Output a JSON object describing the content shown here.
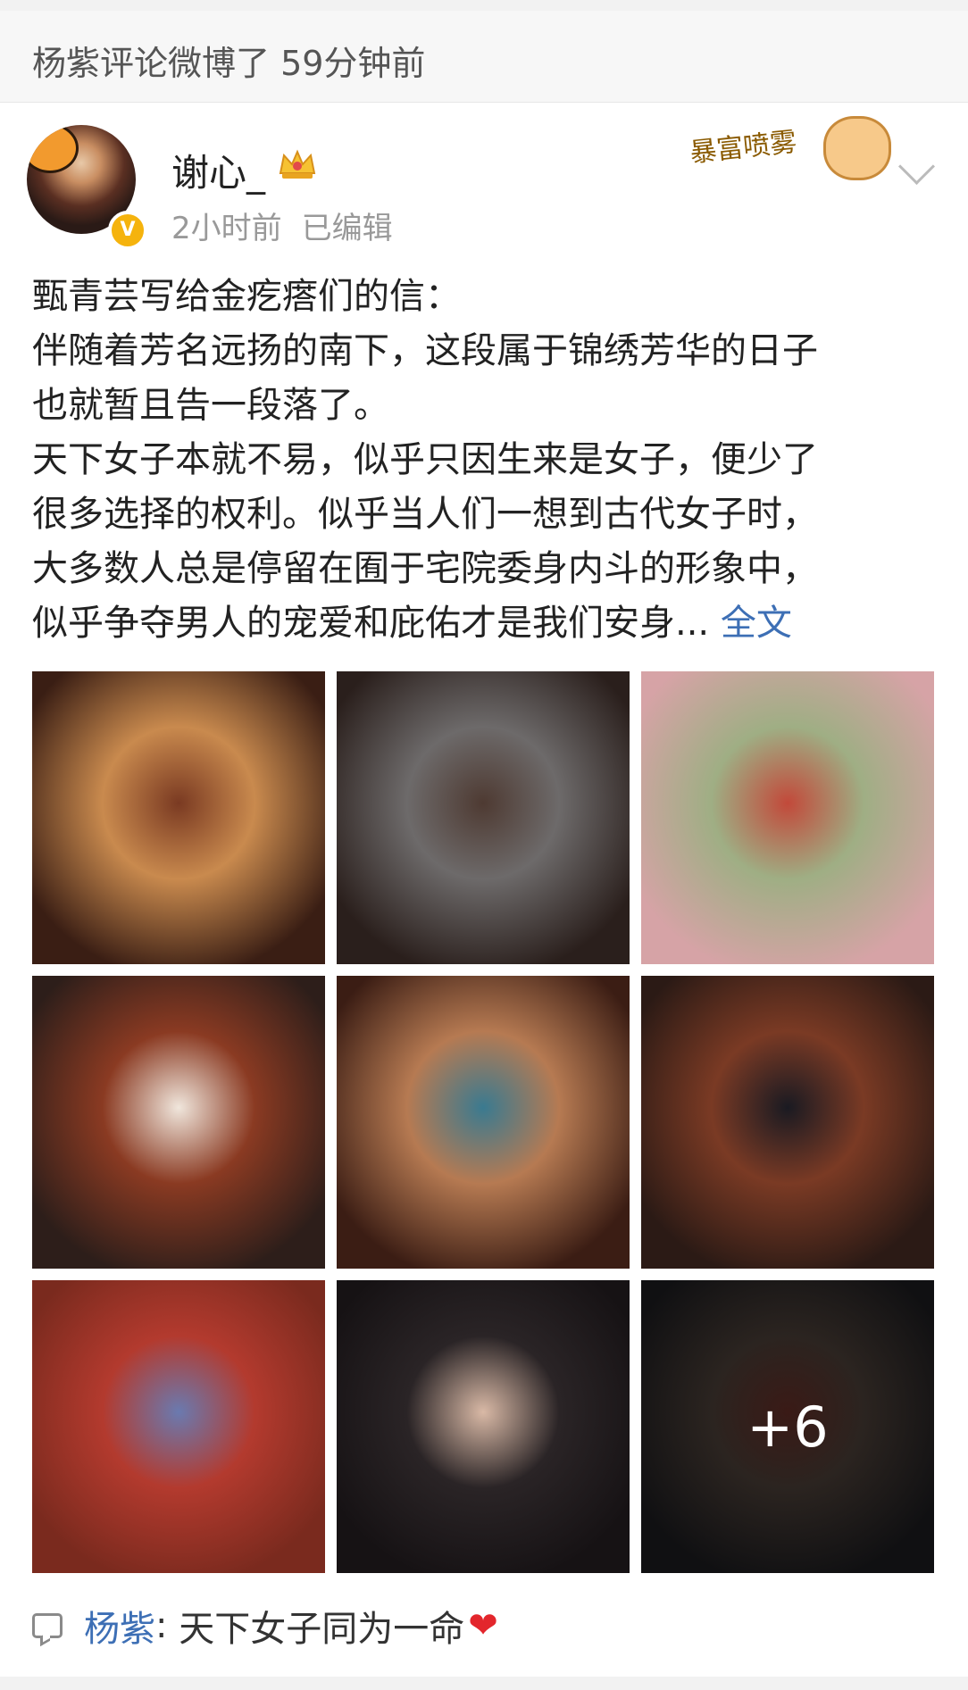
{
  "notification": {
    "text": "杨紫评论微博了 59分钟前"
  },
  "author": {
    "name": "谢心_",
    "time": "2小时前",
    "edited": "已编辑",
    "verified_badge": "V"
  },
  "sticker": {
    "text": "暴富喷雾"
  },
  "post": {
    "lines": [
      "甄青芸写给金疙瘩们的信：",
      "伴随着芳名远扬的南下，这段属于锦绣芳华的日子",
      "也就暂且告一段落了。",
      "天下女子本就不易，似乎只因生来是女子，便少了",
      "很多选择的权利。似乎当人们一想到古代女子时，",
      "大多数人总是停留在囿于宅院委身内斗的形象中，",
      "似乎争夺男人的宠爱和庇佑才是我们安身..."
    ],
    "full_text_link": "全文"
  },
  "photos": {
    "items": [
      {
        "name": "photo-1",
        "colors": [
          "#3a1e14",
          "#c98a4e",
          "#7a3a22"
        ]
      },
      {
        "name": "photo-2",
        "colors": [
          "#2a1f1c",
          "#6d6a6a",
          "#4e3a32"
        ]
      },
      {
        "name": "photo-3",
        "colors": [
          "#d6a3a6",
          "#9fae84",
          "#c2493a"
        ]
      },
      {
        "name": "photo-4",
        "colors": [
          "#2d1e1a",
          "#8a3a22",
          "#f0e6dc"
        ]
      },
      {
        "name": "photo-5",
        "colors": [
          "#3b1d14",
          "#b67a52",
          "#3a7a90"
        ]
      },
      {
        "name": "photo-6",
        "colors": [
          "#2b1a15",
          "#7a3a24",
          "#1a1a22"
        ]
      },
      {
        "name": "photo-7",
        "colors": [
          "#7a2a1e",
          "#b33a2e",
          "#6a7ab0"
        ]
      },
      {
        "name": "photo-8",
        "colors": [
          "#161214",
          "#2a2426",
          "#d9b9a6"
        ]
      },
      {
        "name": "photo-9",
        "colors": [
          "#101012",
          "#2b2420",
          "#3a1a16"
        ]
      }
    ],
    "more_count": "+6"
  },
  "comment": {
    "commenter": "杨紫",
    "separator": ":",
    "text": "天下女子同为一命",
    "heart": "❤"
  }
}
